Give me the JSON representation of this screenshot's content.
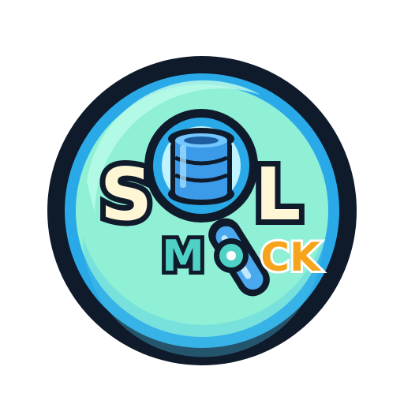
{
  "logo": {
    "word_top_left": "S",
    "word_top_middle": "Q",
    "word_top_right": "L",
    "word_bottom_m": "M",
    "word_bottom_o": "O",
    "word_bottom_ck": "CK",
    "colors": {
      "outer_ring": "#0f1a2b",
      "inner_ring": "#2aa9e8",
      "disc_fill": "#8ff0d6",
      "disc_highlight": "#b9fbe7",
      "letter_fill": "#fff6d6",
      "letter_outline": "#0f1a2b",
      "mock_teal": "#4fd1c5",
      "mock_orange": "#f7a41d",
      "magnifier_rim": "#2aa9e8",
      "magnifier_lens": "#bff3ff",
      "database_blue": "#3b9be8",
      "handle_blue": "#4aa8ee"
    },
    "icons": [
      "magnifying-glass-icon",
      "database-icon"
    ]
  }
}
